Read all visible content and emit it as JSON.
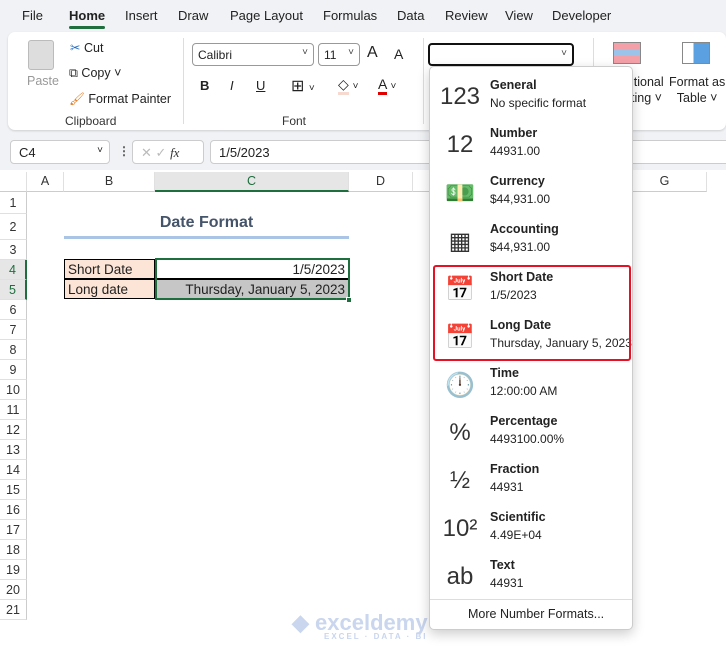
{
  "menu_tabs": [
    "File",
    "Home",
    "Insert",
    "Draw",
    "Page Layout",
    "Formulas",
    "Data",
    "Review",
    "View",
    "Developer"
  ],
  "clipboard": {
    "paste": "Paste",
    "cut": "Cut",
    "copy": "Copy",
    "format_painter": "Format Painter",
    "label": "Clipboard"
  },
  "font": {
    "name": "Calibri",
    "size": "11",
    "bold": "B",
    "italic": "I",
    "underline": "U",
    "label": "Font",
    "grow": "A",
    "shrink": "A",
    "color": "A"
  },
  "number_format_value": "",
  "styles": {
    "conditional": "Conditional Formatting",
    "conditional_visible_1": "itional",
    "conditional_visible_2": "ting",
    "format_table_1": "Format as",
    "format_table_2": "Table"
  },
  "formula_bar": {
    "name_box": "C4",
    "fx": "fx",
    "value": "1/5/2023"
  },
  "columns": [
    "A",
    "B",
    "C",
    "D",
    "G"
  ],
  "rows": [
    "1",
    "2",
    "3",
    "4",
    "5",
    "6",
    "7",
    "8",
    "9",
    "10",
    "11",
    "12",
    "13",
    "14",
    "15",
    "16",
    "17",
    "18",
    "19",
    "20",
    "21"
  ],
  "sheet": {
    "title": "Date Format",
    "b4": "Short Date",
    "c4": "1/5/2023",
    "b5": "Long date",
    "c5": "Thursday, January 5, 2023"
  },
  "formats": [
    {
      "name": "General",
      "example": "No specific format",
      "icon": "general-icon",
      "glyph": "123"
    },
    {
      "name": "Number",
      "example": "44931.00",
      "icon": "number-icon",
      "glyph": "12"
    },
    {
      "name": "Currency",
      "example": "$44,931.00",
      "icon": "currency-icon",
      "glyph": ""
    },
    {
      "name": "Accounting",
      "example": "$44,931.00",
      "icon": "accounting-icon",
      "glyph": ""
    },
    {
      "name": "Short Date",
      "example": "1/5/2023",
      "icon": "calendar-icon",
      "glyph": ""
    },
    {
      "name": "Long Date",
      "example": "Thursday, January 5, 2023",
      "icon": "calendar-icon",
      "glyph": ""
    },
    {
      "name": "Time",
      "example": "12:00:00 AM",
      "icon": "clock-icon",
      "glyph": ""
    },
    {
      "name": "Percentage",
      "example": "4493100.00%",
      "icon": "percent-icon",
      "glyph": "%"
    },
    {
      "name": "Fraction",
      "example": "44931",
      "icon": "fraction-icon",
      "glyph": "½"
    },
    {
      "name": "Scientific",
      "example": "4.49E+04",
      "icon": "scientific-icon",
      "glyph": "10²"
    },
    {
      "name": "Text",
      "example": "44931",
      "icon": "text-icon",
      "glyph": "ab"
    }
  ],
  "more_formats": "More Number Formats...",
  "watermark": {
    "brand": "exceldemy",
    "tagline": "EXCEL · DATA · BI"
  },
  "colors": {
    "accent": "#1e6e3e",
    "highlight": "#e81123",
    "label_fill": "#fce4d6"
  }
}
